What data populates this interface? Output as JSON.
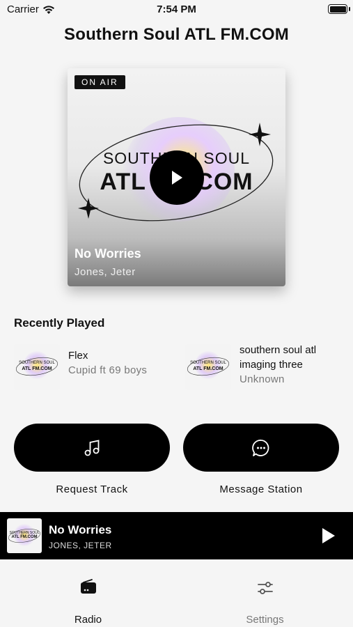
{
  "status_bar": {
    "carrier": "Carrier",
    "time": "7:54 PM"
  },
  "header": {
    "title": "Southern Soul ATL FM.COM"
  },
  "now_playing": {
    "badge": "ON AIR",
    "art_line1": "SOUTHERN SOUL",
    "art_line2": "ATL FM.COM",
    "title": "No Worries",
    "artist": "Jones, Jeter"
  },
  "recently_played": {
    "heading": "Recently Played",
    "items": [
      {
        "title": "Flex",
        "subtitle": "Cupid ft 69 boys",
        "thumb_line1": "SOUTHERN SOUL",
        "thumb_line2": "ATL FM.COM"
      },
      {
        "title_line1": "southern soul atl",
        "title_line2": "imaging three",
        "subtitle": "Unknown",
        "thumb_line1": "SOUTHERN SOUL",
        "thumb_line2": "ATL FM.COM"
      }
    ]
  },
  "actions": {
    "request_label": "Request Track",
    "message_label": "Message Station"
  },
  "mini_player": {
    "title": "No Worries",
    "artist": "JONES, JETER",
    "thumb_line1": "SOUTHERN SOUL",
    "thumb_line2": "ATL FM.COM"
  },
  "tabs": [
    {
      "label": "Radio",
      "icon": "radio-icon",
      "active": true
    },
    {
      "label": "Settings",
      "icon": "sliders-icon",
      "active": false
    }
  ],
  "colors": {
    "accent": "#000000",
    "background": "#f5f5f5",
    "muted_text": "#777777"
  }
}
